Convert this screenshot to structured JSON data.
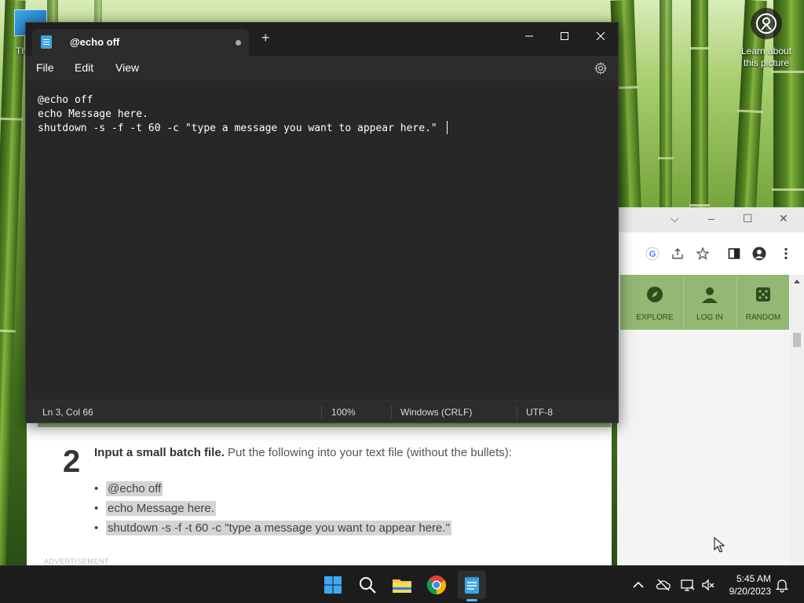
{
  "desktop": {
    "icon_label_partial": "Th",
    "learn_about": "Learn about this picture"
  },
  "notepad": {
    "tab_title": "@echo off",
    "new_tab_label": "+",
    "menu": [
      "File",
      "Edit",
      "View"
    ],
    "lines": [
      "@echo off",
      "echo Message here.",
      "shutdown -s -f -t 60 -c \"type a message you want to appear here.\""
    ],
    "status": {
      "position": "Ln 3, Col 66",
      "zoom": "100%",
      "line_ending": "Windows (CRLF)",
      "encoding": "UTF-8"
    }
  },
  "browser": {
    "site_nav": [
      {
        "label": "EXPLORE",
        "icon": "compass-icon"
      },
      {
        "label": "LOG IN",
        "icon": "person-icon"
      },
      {
        "label": "RANDOM",
        "icon": "dice-icon"
      }
    ]
  },
  "article": {
    "step_number": "2",
    "step_bold": "Input a small batch file.",
    "step_rest": " Put the following into your text file (without the bullets):",
    "bullets": [
      "@echo off",
      "echo Message here.",
      "shutdown -s -f -t 60 -c \"type a message you want to appear here.\""
    ],
    "advertisement": "ADVERTISEMENT"
  },
  "taskbar": {
    "apps": [
      "start-icon",
      "search-icon",
      "file-explorer-icon",
      "chrome-icon",
      "notepad-icon"
    ],
    "time": "5:45 AM",
    "date": "9/20/2023"
  },
  "colors": {
    "notepad_bg": "#272727",
    "accent": "#5fb2f2",
    "site_green": "#93b874"
  }
}
